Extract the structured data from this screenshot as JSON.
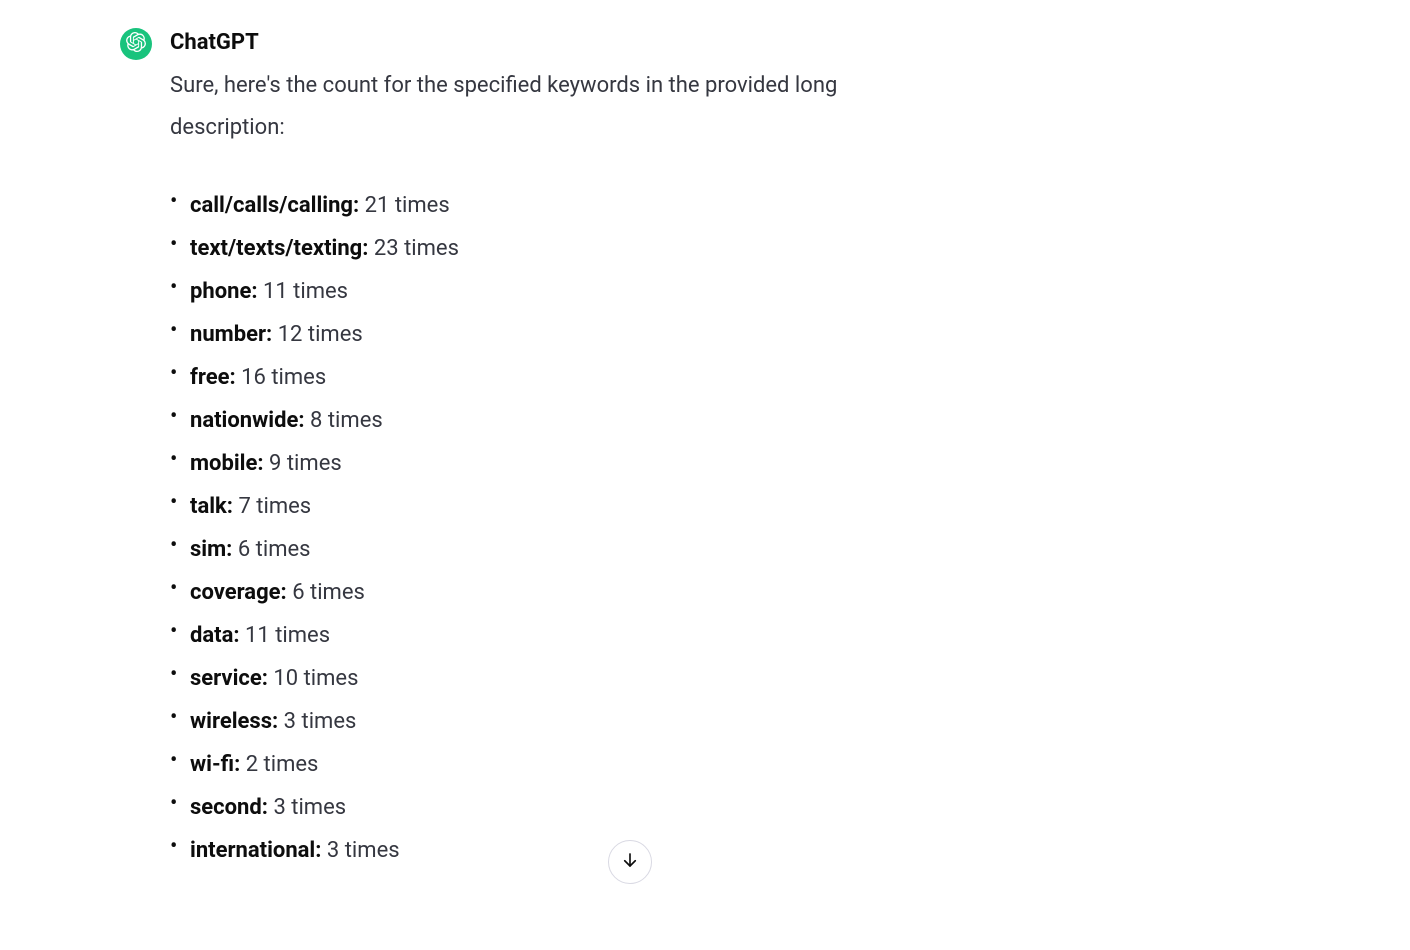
{
  "message": {
    "sender": "ChatGPT",
    "intro": "Sure, here's the count for the specified keywords in the provided long description:",
    "items": [
      {
        "keyword": "call/calls/calling:",
        "count": "21 times"
      },
      {
        "keyword": "text/texts/texting:",
        "count": "23 times"
      },
      {
        "keyword": "phone:",
        "count": "11 times"
      },
      {
        "keyword": "number:",
        "count": "12 times"
      },
      {
        "keyword": "free:",
        "count": "16 times"
      },
      {
        "keyword": "nationwide:",
        "count": "8 times"
      },
      {
        "keyword": "mobile:",
        "count": "9 times"
      },
      {
        "keyword": "talk:",
        "count": "7 times"
      },
      {
        "keyword": "sim:",
        "count": "6 times"
      },
      {
        "keyword": "coverage:",
        "count": "6 times"
      },
      {
        "keyword": "data:",
        "count": "11 times"
      },
      {
        "keyword": "service:",
        "count": "10 times"
      },
      {
        "keyword": "wireless:",
        "count": "3 times"
      },
      {
        "keyword": "wi-fi:",
        "count": "2 times"
      },
      {
        "keyword": "second:",
        "count": "3 times"
      },
      {
        "keyword": "international:",
        "count": "3 times"
      }
    ]
  }
}
